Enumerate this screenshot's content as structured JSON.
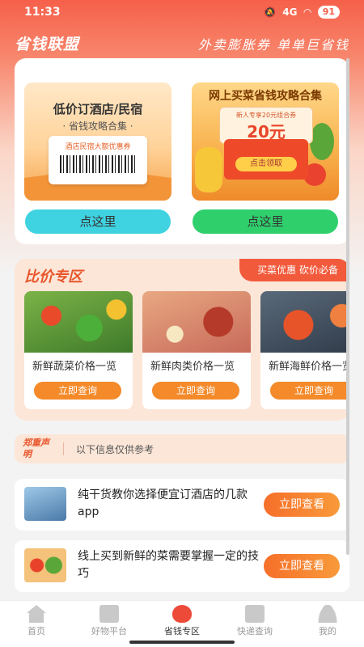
{
  "status_bar": {
    "time": "11:33",
    "network": "4G",
    "battery": "91"
  },
  "header": {
    "app_title": "省钱联盟",
    "slogan": "外卖膨胀券 单单巨省钱"
  },
  "promo": {
    "left": {
      "title": "低价订酒店/民宿",
      "subtitle": "· 省钱攻略合集 ·",
      "coupon_text": "酒店民宿大额优惠券",
      "button": "点这里"
    },
    "right": {
      "title": "网上买菜省钱攻略合集",
      "voucher_text": "新人专享20元组合券",
      "voucher_amount": "20元",
      "claim": "点击领取",
      "button": "点这里"
    }
  },
  "compare": {
    "title": "比价专区",
    "tag": "买菜优惠 砍价必备",
    "products": [
      {
        "name": "新鲜蔬菜价格一览",
        "button": "立即查询"
      },
      {
        "name": "新鲜肉类价格一览",
        "button": "立即查询"
      },
      {
        "name": "新鲜海鲜价格一览",
        "button": "立即查询"
      }
    ]
  },
  "notice": {
    "badge": "郑重声明",
    "text": "以下信息仅供参考"
  },
  "articles": [
    {
      "text": "纯干货教你选择便宜订酒店的几款app",
      "button": "立即查看"
    },
    {
      "text": "线上买到新鲜的菜需要掌握一定的技巧",
      "button": "立即查看"
    }
  ],
  "tabbar": [
    {
      "label": "首页",
      "icon": "home-icon",
      "active": false
    },
    {
      "label": "好物平台",
      "icon": "shop-icon",
      "active": false
    },
    {
      "label": "省钱专区",
      "icon": "piggy-bank-icon",
      "active": true
    },
    {
      "label": "快递查询",
      "icon": "parcel-icon",
      "active": false
    },
    {
      "label": "我的",
      "icon": "user-icon",
      "active": false
    }
  ],
  "colors": {
    "accent": "#f6604a",
    "cta_left": "#3fd2e0",
    "cta_right": "#2fd06c",
    "orange_button": "#f48a2a"
  }
}
